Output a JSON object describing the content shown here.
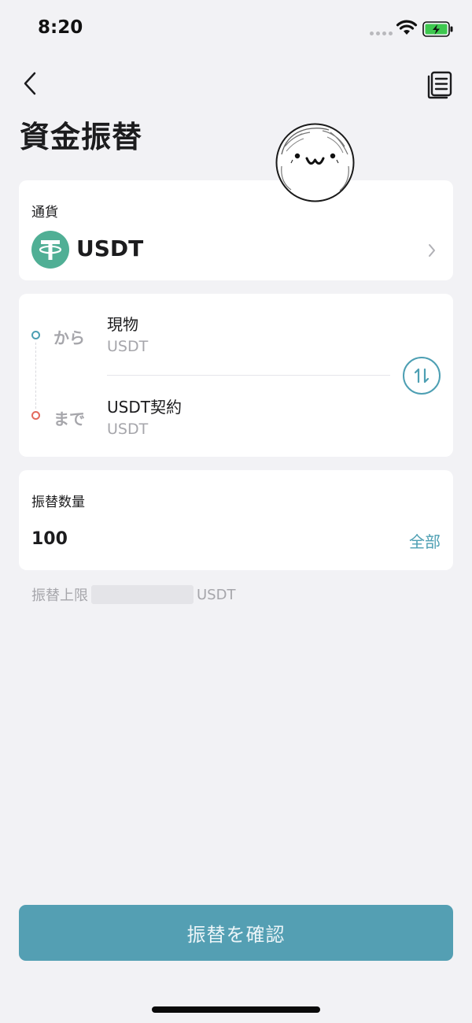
{
  "status_bar": {
    "time": "8:20"
  },
  "header": {
    "title": "資金振替"
  },
  "currency": {
    "label": "通貨",
    "value": "USDT"
  },
  "transfer": {
    "from": {
      "direction_label": "から",
      "account": "現物",
      "currency": "USDT"
    },
    "to": {
      "direction_label": "まで",
      "account": "USDT契約",
      "currency": "USDT"
    }
  },
  "amount": {
    "label": "振替数量",
    "value": "100",
    "all_label": "全部"
  },
  "limit": {
    "label": "振替上限",
    "unit": "USDT"
  },
  "confirm": {
    "label": "振替を確認"
  },
  "colors": {
    "accent": "#549fb3",
    "from_dot": "#4d9fb3",
    "to_dot": "#e36a5d",
    "coin": "#50af95",
    "background": "#f2f2f5"
  }
}
